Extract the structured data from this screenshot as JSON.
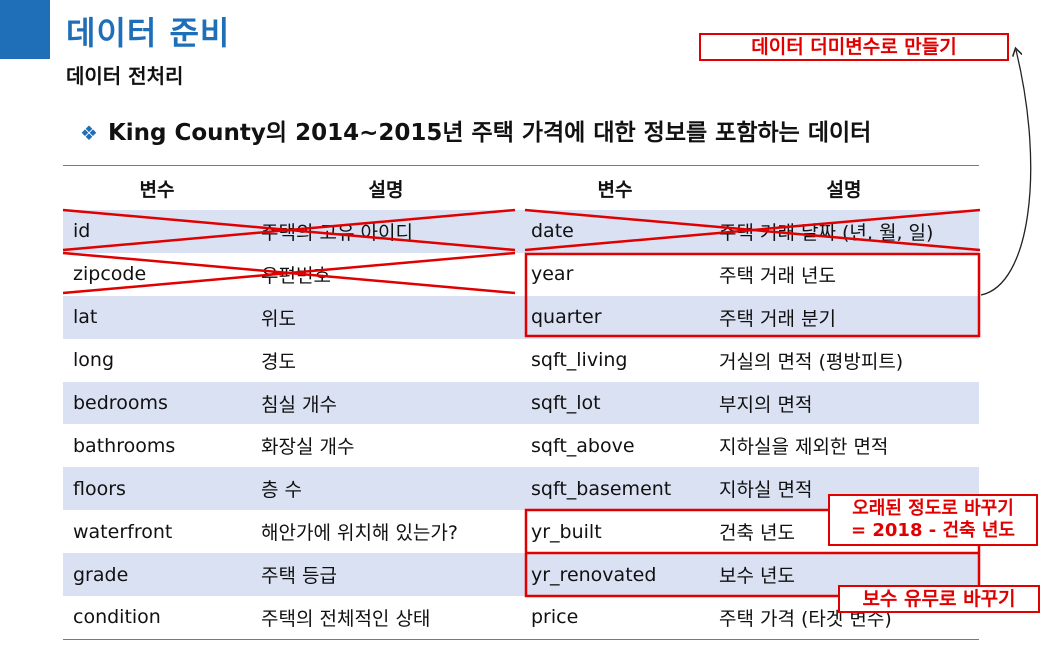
{
  "header": {
    "title": "데이터 준비",
    "subtitle": "데이터 전처리",
    "bullet_mark": "❖",
    "bullet_text": "King County의 2014~2015년 주택 가격에 대한 정보를 포함하는 데이터"
  },
  "table": {
    "headers": [
      "변수",
      "설명",
      "변수",
      "설명"
    ],
    "rows": [
      [
        "id",
        "주택의 고유 아이디",
        "date",
        "주택 거래 날짜 (년, 월, 일)"
      ],
      [
        "zipcode",
        "우편번호",
        "year",
        "주택 거래 년도"
      ],
      [
        "lat",
        "위도",
        "quarter",
        "주택 거래 분기"
      ],
      [
        "long",
        "경도",
        "sqft_living",
        "거실의 면적 (평방피트)"
      ],
      [
        "bedrooms",
        "침실 개수",
        "sqft_lot",
        "부지의 면적"
      ],
      [
        "bathrooms",
        "화장실 개수",
        "sqft_above",
        "지하실을 제외한 면적"
      ],
      [
        "floors",
        "층 수",
        "sqft_basement",
        "지하실 면적"
      ],
      [
        "waterfront",
        "해안가에 위치해 있는가?",
        "yr_built",
        "건축 년도"
      ],
      [
        "grade",
        "주택 등급",
        "yr_renovated",
        "보수 년도"
      ],
      [
        "condition",
        "주택의 전체적인 상태",
        "price",
        "주택 가격 (타겟 변수)"
      ]
    ]
  },
  "annotations": {
    "dummy_callout": "데이터 더미변수로 만들기",
    "age_callout_line1": "오래된 정도로 바꾸기",
    "age_callout_line2": "= 2018 - 건축 년도",
    "reno_callout": "보수 유무로 바꾸기"
  },
  "colors": {
    "accent": "#1f6fb8",
    "alt_row": "#d9e1f2",
    "markup_red": "#e00000"
  }
}
